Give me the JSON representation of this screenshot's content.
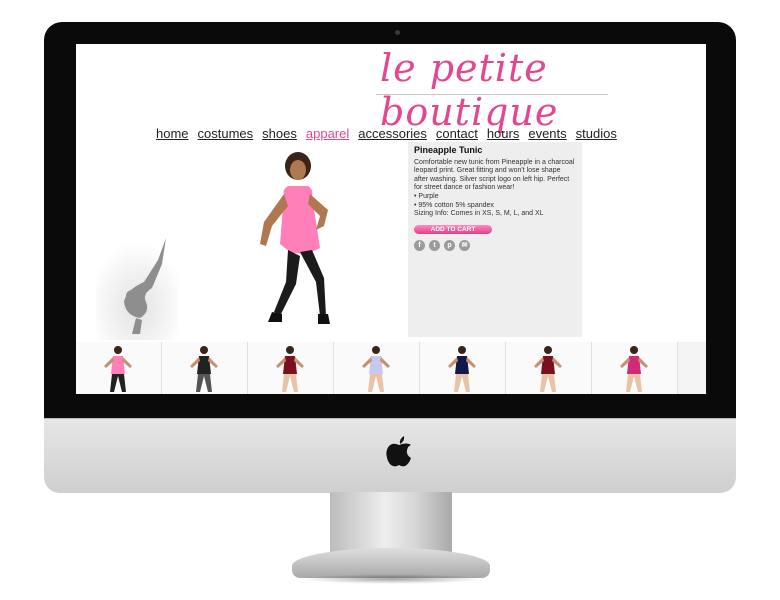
{
  "site": {
    "logo_text": "le petite boutique"
  },
  "nav": {
    "items": [
      {
        "label": "home",
        "active": false
      },
      {
        "label": "costumes",
        "active": false
      },
      {
        "label": "shoes",
        "active": false
      },
      {
        "label": "apparel",
        "active": true
      },
      {
        "label": "accessories",
        "active": false
      },
      {
        "label": "contact",
        "active": false
      },
      {
        "label": "hours",
        "active": false
      },
      {
        "label": "events",
        "active": false
      },
      {
        "label": "studios",
        "active": false
      }
    ]
  },
  "product": {
    "title": "Pineapple Tunic",
    "description": "Comfortable new tunic from Pineapple in a charcoal leopard print. Great fitting and won't lose shape after washing. Silver script logo on left hip. Perfect for street dance or fashion wear!",
    "bullets": [
      "• Purple",
      "• 95% cotton 5% spandex"
    ],
    "sizing": "Sizing Info: Comes in XS, S, M, L, and XL",
    "cart_label": "ADD TO CART"
  },
  "social": {
    "icons": [
      {
        "name": "facebook-icon",
        "glyph": "f"
      },
      {
        "name": "tumblr-icon",
        "glyph": "t"
      },
      {
        "name": "pinterest-icon",
        "glyph": "p"
      },
      {
        "name": "email-icon",
        "glyph": "✉"
      }
    ]
  },
  "thumbnails": [
    {
      "outfit": "#ff7fb8",
      "legs": "#222"
    },
    {
      "outfit": "#222",
      "legs": "#555"
    },
    {
      "outfit": "#7a0f1d",
      "legs": "#e8c3a8"
    },
    {
      "outfit": "#c8c8ee",
      "legs": "#e8c3a8"
    },
    {
      "outfit": "#101a4a",
      "legs": "#e8c3a8"
    },
    {
      "outfit": "#7a0f1d",
      "legs": "#e8c3a8"
    },
    {
      "outfit": "#d02a78",
      "legs": "#e8c3a8"
    }
  ],
  "colors": {
    "accent": "#e2478f",
    "info_bg": "#eeeeee"
  }
}
